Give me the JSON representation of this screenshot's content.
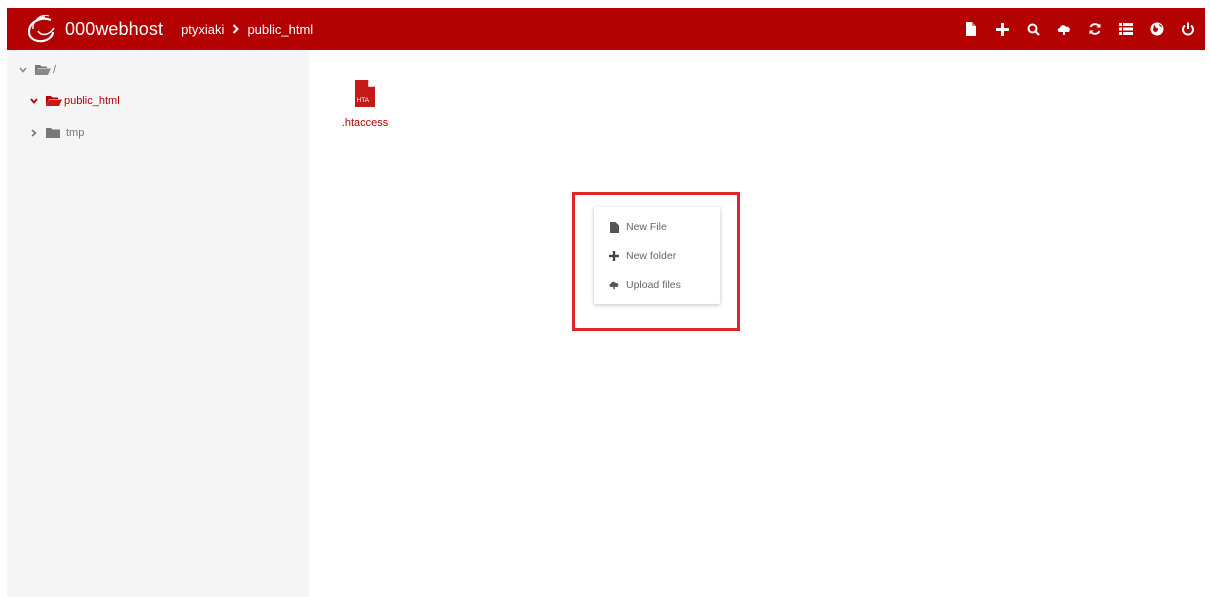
{
  "app": {
    "brand": "000webhost",
    "icon": "swirl-logo-icon",
    "colors": {
      "primary": "#b30000",
      "highlight": "#e0242c",
      "sidebar_bg": "#f5f5f5"
    }
  },
  "breadcrumb": {
    "items": [
      "ptyxiaki",
      "public_html"
    ],
    "separator_icon": "chevron-right-icon"
  },
  "toolbar": {
    "icons": [
      "new-file-icon",
      "new-folder-plus-icon",
      "search-icon",
      "upload-icon",
      "refresh-icon",
      "list-view-icon",
      "globe-icon",
      "power-icon"
    ]
  },
  "sidebar": {
    "tree": [
      {
        "label": "/",
        "expanded": true,
        "active": false
      },
      {
        "label": "public_html",
        "expanded": true,
        "active": true
      },
      {
        "label": "tmp",
        "expanded": false,
        "active": false
      }
    ]
  },
  "files": [
    {
      "name": ".htaccess",
      "badge": "HTA"
    }
  ],
  "context_menu": {
    "items": [
      {
        "label": "New File",
        "icon": "file-icon"
      },
      {
        "label": "New folder",
        "icon": "plus-icon"
      },
      {
        "label": "Upload files",
        "icon": "cloud-upload-icon"
      }
    ]
  }
}
